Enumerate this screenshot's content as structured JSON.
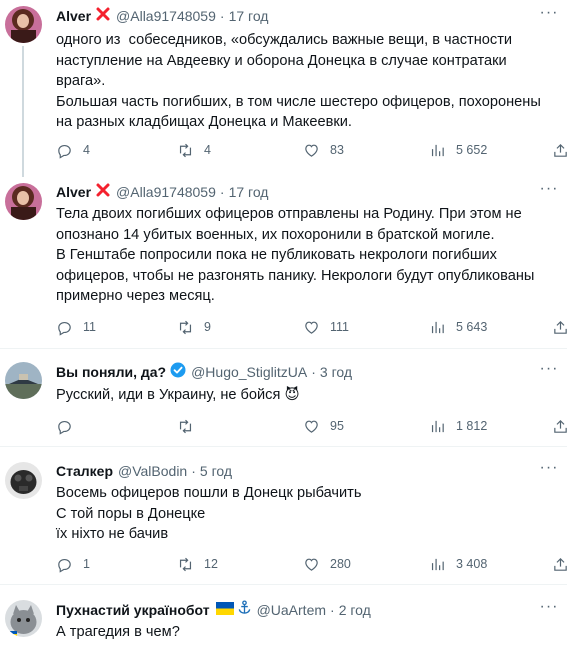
{
  "tweets": [
    {
      "name": "Alver",
      "badge": "red-x",
      "handle": "@Alla91748059",
      "time": "17 год",
      "text": "одного из  собеседников, «обсуждались важные вещи, в частности\nнаступление на Авдеевку и оборона Донецка в случае контратаки\nврага».\nБольшая часть погибших, в том числе шестеро офицеров, похоронены\nна разных кладбищах Донецка и Макеевки.",
      "replies": "4",
      "retweets": "4",
      "likes": "83",
      "views": "5 652"
    },
    {
      "name": "Alver",
      "badge": "red-x",
      "handle": "@Alla91748059",
      "time": "17 год",
      "text": "Тела двоих погибших офицеров отправлены на Родину. При этом не\nопознано 14 убитых военных, их похоронили в братской могиле.\nВ Генштабе попросили пока не публиковать некрологи погибших\nофицеров, чтобы не разгонять панику. Некрологи будут опубликованы\nпримерно через месяц.",
      "replies": "11",
      "retweets": "9",
      "likes": "111",
      "views": "5 643"
    },
    {
      "name": "Вы поняли, да?",
      "badge": "verified",
      "handle": "@Hugo_StiglitzUA",
      "time": "3 год",
      "text": "Русский, иди в Украину, не бойся 😈",
      "replies": "",
      "retweets": "",
      "likes": "95",
      "views": "1 812"
    },
    {
      "name": "Сталкер",
      "badge": "",
      "handle": "@ValBodin",
      "time": "5 год",
      "text": "Восемь офицеров пошли в Донецк рыбачить\nС той поры в Донецке\nїх ніхто не бачив",
      "replies": "1",
      "retweets": "12",
      "likes": "280",
      "views": "3 408"
    },
    {
      "name": "Пухнастий українобот",
      "badge": "flag-anchor",
      "handle": "@UaArtem",
      "time": "2 год",
      "text": "А трагедия в чем?",
      "replies": "",
      "retweets": "",
      "likes": "",
      "views": ""
    }
  ],
  "icons": {
    "reply": "reply-icon",
    "retweet": "retweet-icon",
    "like": "like-icon",
    "views": "views-icon",
    "share": "share-icon",
    "more": "more-icon"
  },
  "colors": {
    "text": "#0f1419",
    "secondary": "#536471",
    "verified": "#1d9bf0",
    "red_x": "#f4212e",
    "divider": "#eff3f4"
  }
}
